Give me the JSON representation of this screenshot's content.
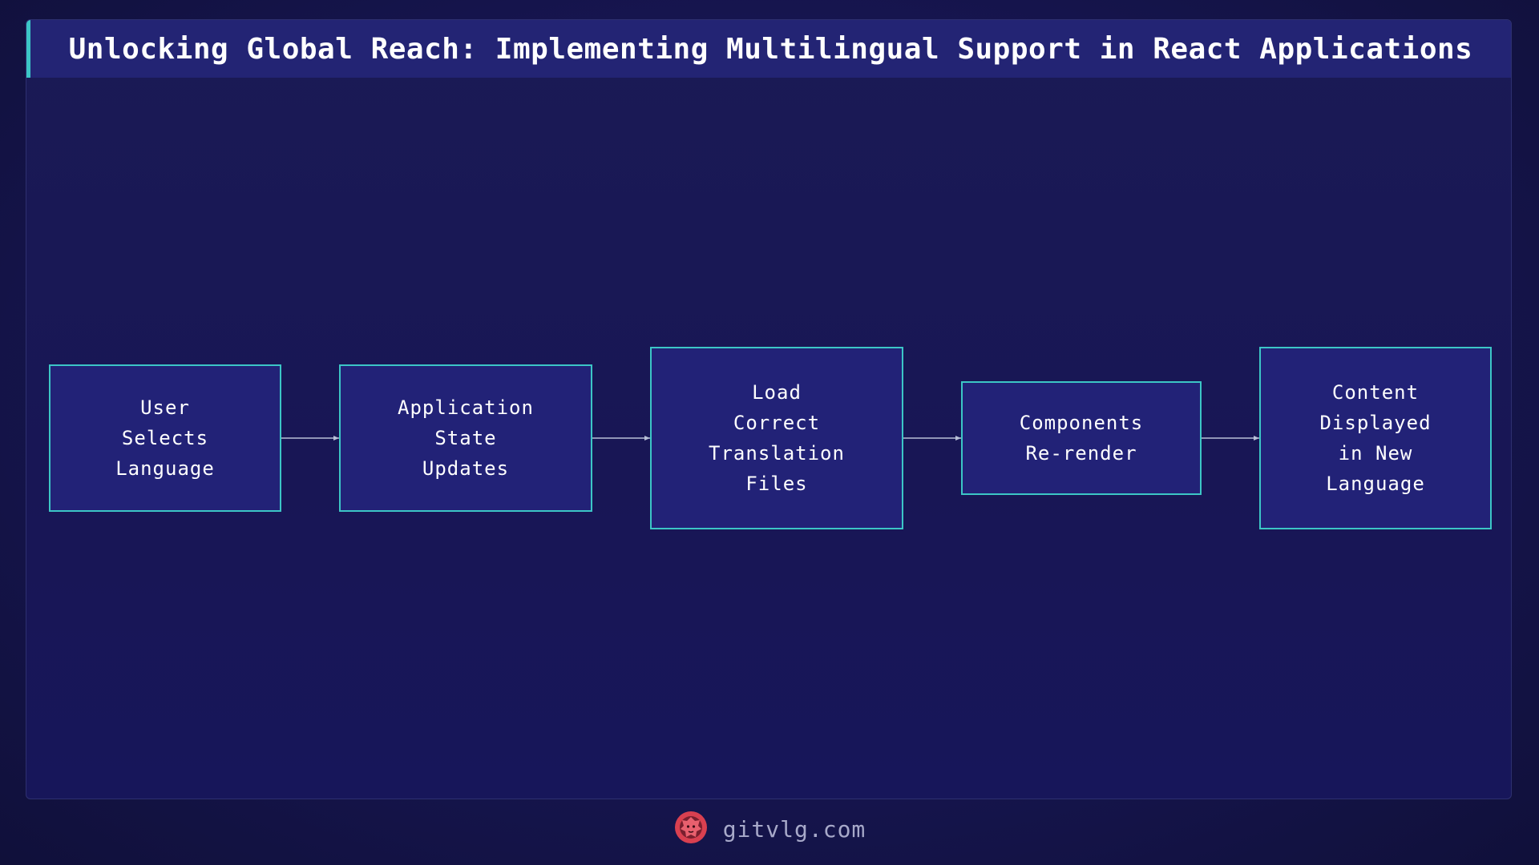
{
  "header": {
    "title": "Unlocking Global Reach: Implementing Multilingual Support in React Applications"
  },
  "diagram": {
    "nodes": [
      {
        "id": "user-selects-language",
        "label": "User\nSelects\nLanguage"
      },
      {
        "id": "application-state-updates",
        "label": "Application\nState\nUpdates"
      },
      {
        "id": "load-translation-files",
        "label": "Load\nCorrect\nTranslation\nFiles"
      },
      {
        "id": "components-rerender",
        "label": "Components\nRe-render"
      },
      {
        "id": "content-displayed",
        "label": "Content\nDisplayed\nin New\nLanguage"
      }
    ],
    "edges": [
      {
        "from": "user-selects-language",
        "to": "application-state-updates"
      },
      {
        "from": "application-state-updates",
        "to": "load-translation-files"
      },
      {
        "from": "load-translation-files",
        "to": "components-rerender"
      },
      {
        "from": "components-rerender",
        "to": "content-displayed"
      }
    ]
  },
  "footer": {
    "logo_icon": "lion-head-icon",
    "site": "gitvlg.com"
  },
  "colors": {
    "node_border": "#3cc6c6",
    "node_fill": "#222277",
    "arrow": "#b8bfd6",
    "logo": "#d94050"
  }
}
